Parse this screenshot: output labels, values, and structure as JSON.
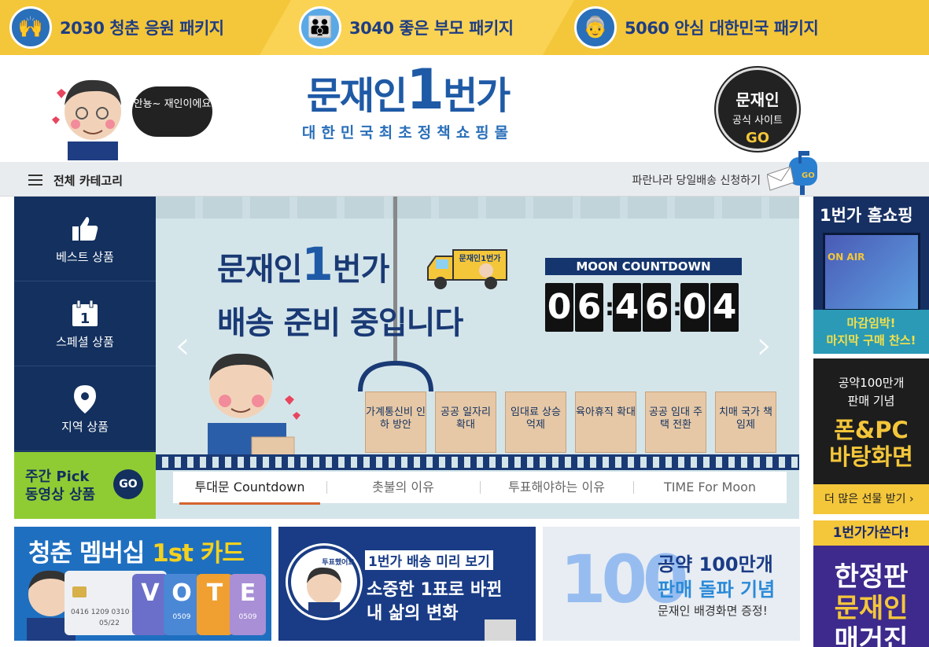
{
  "promo": {
    "items": [
      {
        "label": "2030 청춘 응원 패키지"
      },
      {
        "label": "3040 좋은 부모 패키지"
      },
      {
        "label": "5060 안심 대한민국 패키지"
      }
    ]
  },
  "header": {
    "speech": "안뇽~ 재인이에요",
    "logo_main_pre": "문재인",
    "logo_main_one": "1",
    "logo_main_post": "번가",
    "logo_sub": "대한민국최초정책쇼핑몰",
    "official_l1": "문재인",
    "official_l2": "공식 사이트",
    "official_l3": "GO"
  },
  "navbar": {
    "category_label": "전체 카테고리",
    "delivery_text": "파란나라 당일배송 신청하기",
    "mail_go": "GO"
  },
  "sidebar": {
    "items": [
      {
        "label": "베스트 상품",
        "icon": "thumbs-up-icon"
      },
      {
        "label": "스페셜 상품",
        "icon": "calendar-icon",
        "icon_num": "1"
      },
      {
        "label": "지역 상품",
        "icon": "location-pin-icon"
      }
    ],
    "pick_l1": "주간 Pick",
    "pick_l2": "동영상 상품",
    "pick_go": "GO"
  },
  "hero": {
    "title1_pre": "문재인",
    "title1_one": "1",
    "title1_post": "번가",
    "title2": "배송 준비 중입니다",
    "truck_label": "문재인1번가",
    "countdown_title": "MOON COUNTDOWN",
    "countdown": [
      "0",
      "6",
      "4",
      "6",
      "0",
      "4"
    ],
    "boxes": [
      {
        "label": "가계통신비 인하 방안"
      },
      {
        "label": "공공 일자리 확대"
      },
      {
        "label": "임대료 상승 억제"
      },
      {
        "label": "육아휴직 확대"
      },
      {
        "label": "공공 임대 주택 전환"
      },
      {
        "label": "치매 국가 책임제"
      }
    ],
    "tabs": [
      {
        "label": "투대문 Countdown"
      },
      {
        "label": "촛불의 이유"
      },
      {
        "label": "투표해야하는 이유"
      },
      {
        "label": "TIME For Moon"
      }
    ]
  },
  "right": {
    "homeshop_title": "1번가 홈쇼핑",
    "onair": "ON AIR",
    "homeshop_l1": "마감임박!",
    "homeshop_l2": "마지막 구매 찬스!",
    "gift_l1": "공약100만개",
    "gift_l2": "판매 기념",
    "gift_b1": "폰&PC",
    "gift_b2": "바탕화면",
    "gift_more": "더 많은 선물 받기 ›",
    "limited_top": "1번가가쏜다!",
    "limited_l1": "한정판",
    "limited_l2": "문재인",
    "limited_l3": "매거진"
  },
  "bottom": {
    "card_title_pre": "청춘 멤버십 ",
    "card_title_hl": "1st 카드",
    "card_num": "0416  1209  0310  0509",
    "card_exp": "05/22",
    "vote_letters": [
      "V",
      "O",
      "T",
      "E"
    ],
    "vote_sub": "0509",
    "delivery_l1": "1번가 배송 미리 보기",
    "delivery_l2": "소중한 1표로 바뀐",
    "delivery_l3": "내 삶의 변화",
    "badge_text": "투표했어요",
    "sales_num": "100",
    "sales_l1": "공약 100만개",
    "sales_l2": "판매 돌파 기념",
    "sales_l3": "문재인 배경화면 증정!"
  }
}
